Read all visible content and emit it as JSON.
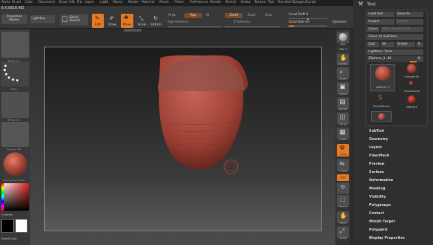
{
  "menu": [
    "Alpha",
    "Brush",
    "Color",
    "Document",
    "Draw",
    "Edit",
    "File",
    "Layer",
    "Light",
    "Macro",
    "Marker",
    "Material",
    "Movie",
    "Picker",
    "Preferences",
    "Render",
    "Stencil",
    "Stroke",
    "Texture",
    "Tool",
    "Transform",
    "Zplugin",
    "Zscript"
  ],
  "toolbar": {
    "coords": "8.8,583,8.482",
    "projection_master": "Projection Master",
    "lightbox": "LightBox",
    "quick_sketch": "Quick Sketch",
    "edit": "Edit",
    "draw": "Draw",
    "move": "Move",
    "scale": "Scale",
    "rotate": "Rotate",
    "mrgb": "Mrgb",
    "rgb": "Rgb",
    "m": "M",
    "zadd": "Zadd",
    "zsub": "Zsub",
    "zcut": "Zcut",
    "rgb_intensity": "Rgb Intensity",
    "z_intensity": "Z Intensity",
    "focal_shift": "Focal Shift 0",
    "draw_size": "Draw Size 64",
    "dynamic": "Dynamic"
  },
  "left_shelf": {
    "items": [
      "Alpha 01",
      "Dots",
      "Brush 00",
      "Texture Off",
      "MatCap Red Wax"
    ],
    "gradient": "Gradient",
    "switch_color": "SwitchColor"
  },
  "right_shelf": [
    "BPR",
    "SPix 3",
    "Scroll",
    "Zoom",
    "Actual",
    "AAHalf",
    "Persp",
    "Floor",
    "Local",
    "L.Sym",
    "XYZ",
    "Frame",
    "Move",
    "Scale"
  ],
  "tool_panel": {
    "title": "Tool",
    "load_tool": "Load Tool",
    "save_as": "Save As",
    "import": "Import",
    "export": "Export",
    "clone": "Clone",
    "make_polymesh": "Make PolyMesh3D",
    "clone_all": "Clone All SubTools",
    "goz": "GoZ",
    "all": "All",
    "visible": "Visible",
    "r": "R",
    "lightbox_tools": "Lightbox› Tools",
    "current_tool": "ZSphere_1. 46",
    "tiles": [
      "Cylinder3D",
      "PolyMesh3D",
      "SimpleBrush",
      "ZSphere",
      "Zsphere_1"
    ],
    "subpalettes": [
      "SubTool",
      "Geometry",
      "Layers",
      "FiberMesh",
      "Preview",
      "Surface",
      "Deformation",
      "Masking",
      "Visibility",
      "Polygroups",
      "Contact",
      "Morph Target",
      "Polypaint",
      "Display Properties"
    ]
  },
  "colors": {
    "accent": "#e57a24",
    "model": "#a8473b",
    "bg": "#2a2a2a"
  }
}
